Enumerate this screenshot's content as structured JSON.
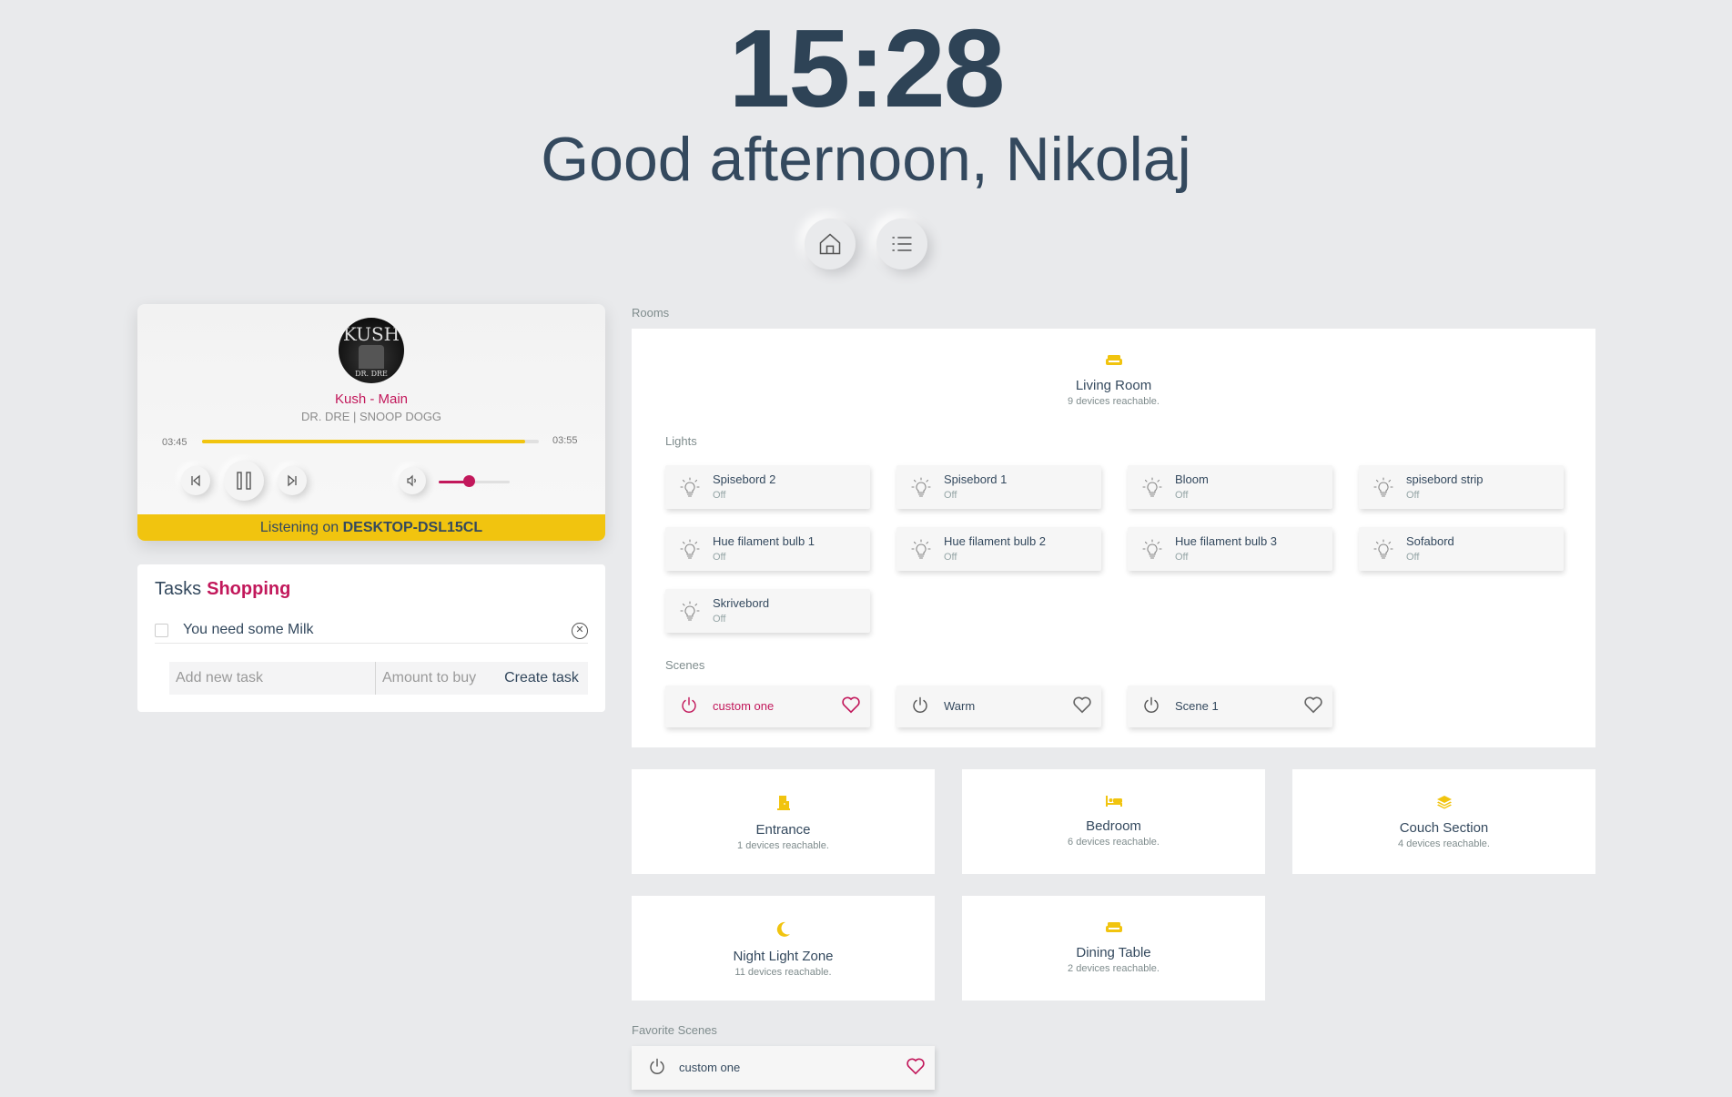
{
  "header": {
    "time": "15:28",
    "greeting": "Good afternoon, Nikolaj",
    "nav": [
      {
        "icon": "home-icon"
      },
      {
        "icon": "list-icon"
      }
    ]
  },
  "player": {
    "album_text": "KUSH",
    "album_subtext": "DR. DRE",
    "title": "Kush - Main",
    "artist": "DR. DRE | SNOOP DOGG",
    "current_time": "03:45",
    "total_time": "03:55",
    "progress": 0.96,
    "volume": 0.42,
    "listening_prefix": "Listening on",
    "device": "DESKTOP-DSL15CL",
    "accent": "#f1c40f",
    "highlight": "#c2185b"
  },
  "tasks": {
    "title": "Tasks",
    "list_name": "Shopping",
    "items": [
      {
        "text": "You need some Milk",
        "done": false
      }
    ],
    "new_task_placeholder": "Add new task",
    "amount_placeholder": "Amount to buy",
    "create_label": "Create task"
  },
  "rooms": {
    "label": "Rooms",
    "featured": {
      "name": "Living Room",
      "reachable": "9 devices reachable.",
      "icon": "sofa-icon",
      "lights_label": "Lights",
      "lights": [
        {
          "name": "Spisebord 2",
          "state": "Off"
        },
        {
          "name": "Spisebord 1",
          "state": "Off"
        },
        {
          "name": "Bloom",
          "state": "Off"
        },
        {
          "name": "spisebord strip",
          "state": "Off"
        },
        {
          "name": "Hue filament bulb 1",
          "state": "Off"
        },
        {
          "name": "Hue filament bulb 2",
          "state": "Off"
        },
        {
          "name": "Hue filament bulb 3",
          "state": "Off"
        },
        {
          "name": "Sofabord",
          "state": "Off"
        },
        {
          "name": "Skrivebord",
          "state": "Off"
        }
      ],
      "scenes_label": "Scenes",
      "scenes": [
        {
          "name": "custom one",
          "active": true,
          "favorite": true
        },
        {
          "name": "Warm",
          "active": false,
          "favorite": false
        },
        {
          "name": "Scene 1",
          "active": false,
          "favorite": false
        }
      ]
    },
    "others": [
      {
        "name": "Entrance",
        "reachable": "1 devices reachable.",
        "icon": "door-icon"
      },
      {
        "name": "Bedroom",
        "reachable": "6 devices reachable.",
        "icon": "bed-icon"
      },
      {
        "name": "Couch Section",
        "reachable": "4 devices reachable.",
        "icon": "layers-icon"
      },
      {
        "name": "Night Light Zone",
        "reachable": "11 devices reachable.",
        "icon": "moon-icon"
      },
      {
        "name": "Dining Table",
        "reachable": "2 devices reachable.",
        "icon": "sofa-icon"
      }
    ]
  },
  "favorites": {
    "label": "Favorite Scenes",
    "items": [
      {
        "name": "custom one",
        "favorite": true
      }
    ]
  },
  "colors": {
    "background": "#e9eaec",
    "text": "#34495e",
    "accent_yellow": "#f1c40f",
    "accent_pink": "#c2185b"
  }
}
